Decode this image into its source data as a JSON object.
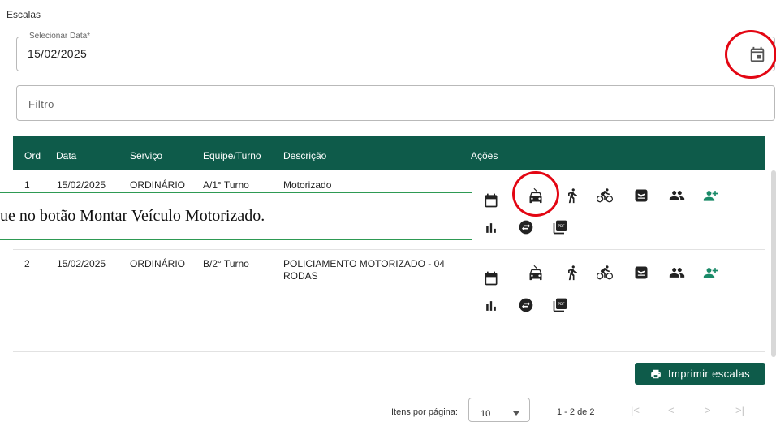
{
  "page": {
    "section_title": "Escalas"
  },
  "date_field": {
    "label": "Selecionar Data*",
    "value": "15/02/2025",
    "calendar_icon": "calendar-icon"
  },
  "filter": {
    "placeholder": "Filtro"
  },
  "table": {
    "headers": [
      "Ord",
      "Data",
      "Serviço",
      "Equipe/Turno",
      "Descrição",
      "Ações"
    ],
    "rows": [
      {
        "ord": "1",
        "data": "15/02/2025",
        "servico": "ORDINÁRIO",
        "equipe": "A/1° Turno",
        "descricao": "Motorizado"
      },
      {
        "ord": "2",
        "data": "15/02/2025",
        "servico": "ORDINÁRIO",
        "equipe": "B/2° Turno",
        "descricao_line1": "POLICIAMENTO MOTORIZADO - 04",
        "descricao_line2": "RODAS"
      }
    ],
    "action_icons": [
      "calendar-icon",
      "car-icon",
      "walk-icon",
      "bike-icon",
      "boat-icon",
      "group-icon",
      "group-add-icon",
      "bar-chart-icon",
      "swap-icon",
      "pdf-icon"
    ]
  },
  "callout": {
    "text": "ue no botão Montar Veículo Motorizado."
  },
  "print_button": {
    "label": "Imprimir escalas"
  },
  "pagination": {
    "items_label": "Itens por página:",
    "page_size": "10",
    "range": "1 - 2 de 2",
    "first": "|<",
    "prev": "<",
    "next": ">",
    "last": ">|"
  },
  "colors": {
    "header_bg": "#0e5b4a",
    "accent_green": "#1a8a68",
    "highlight_red": "#e30613",
    "callout_border": "#2e9a54"
  }
}
